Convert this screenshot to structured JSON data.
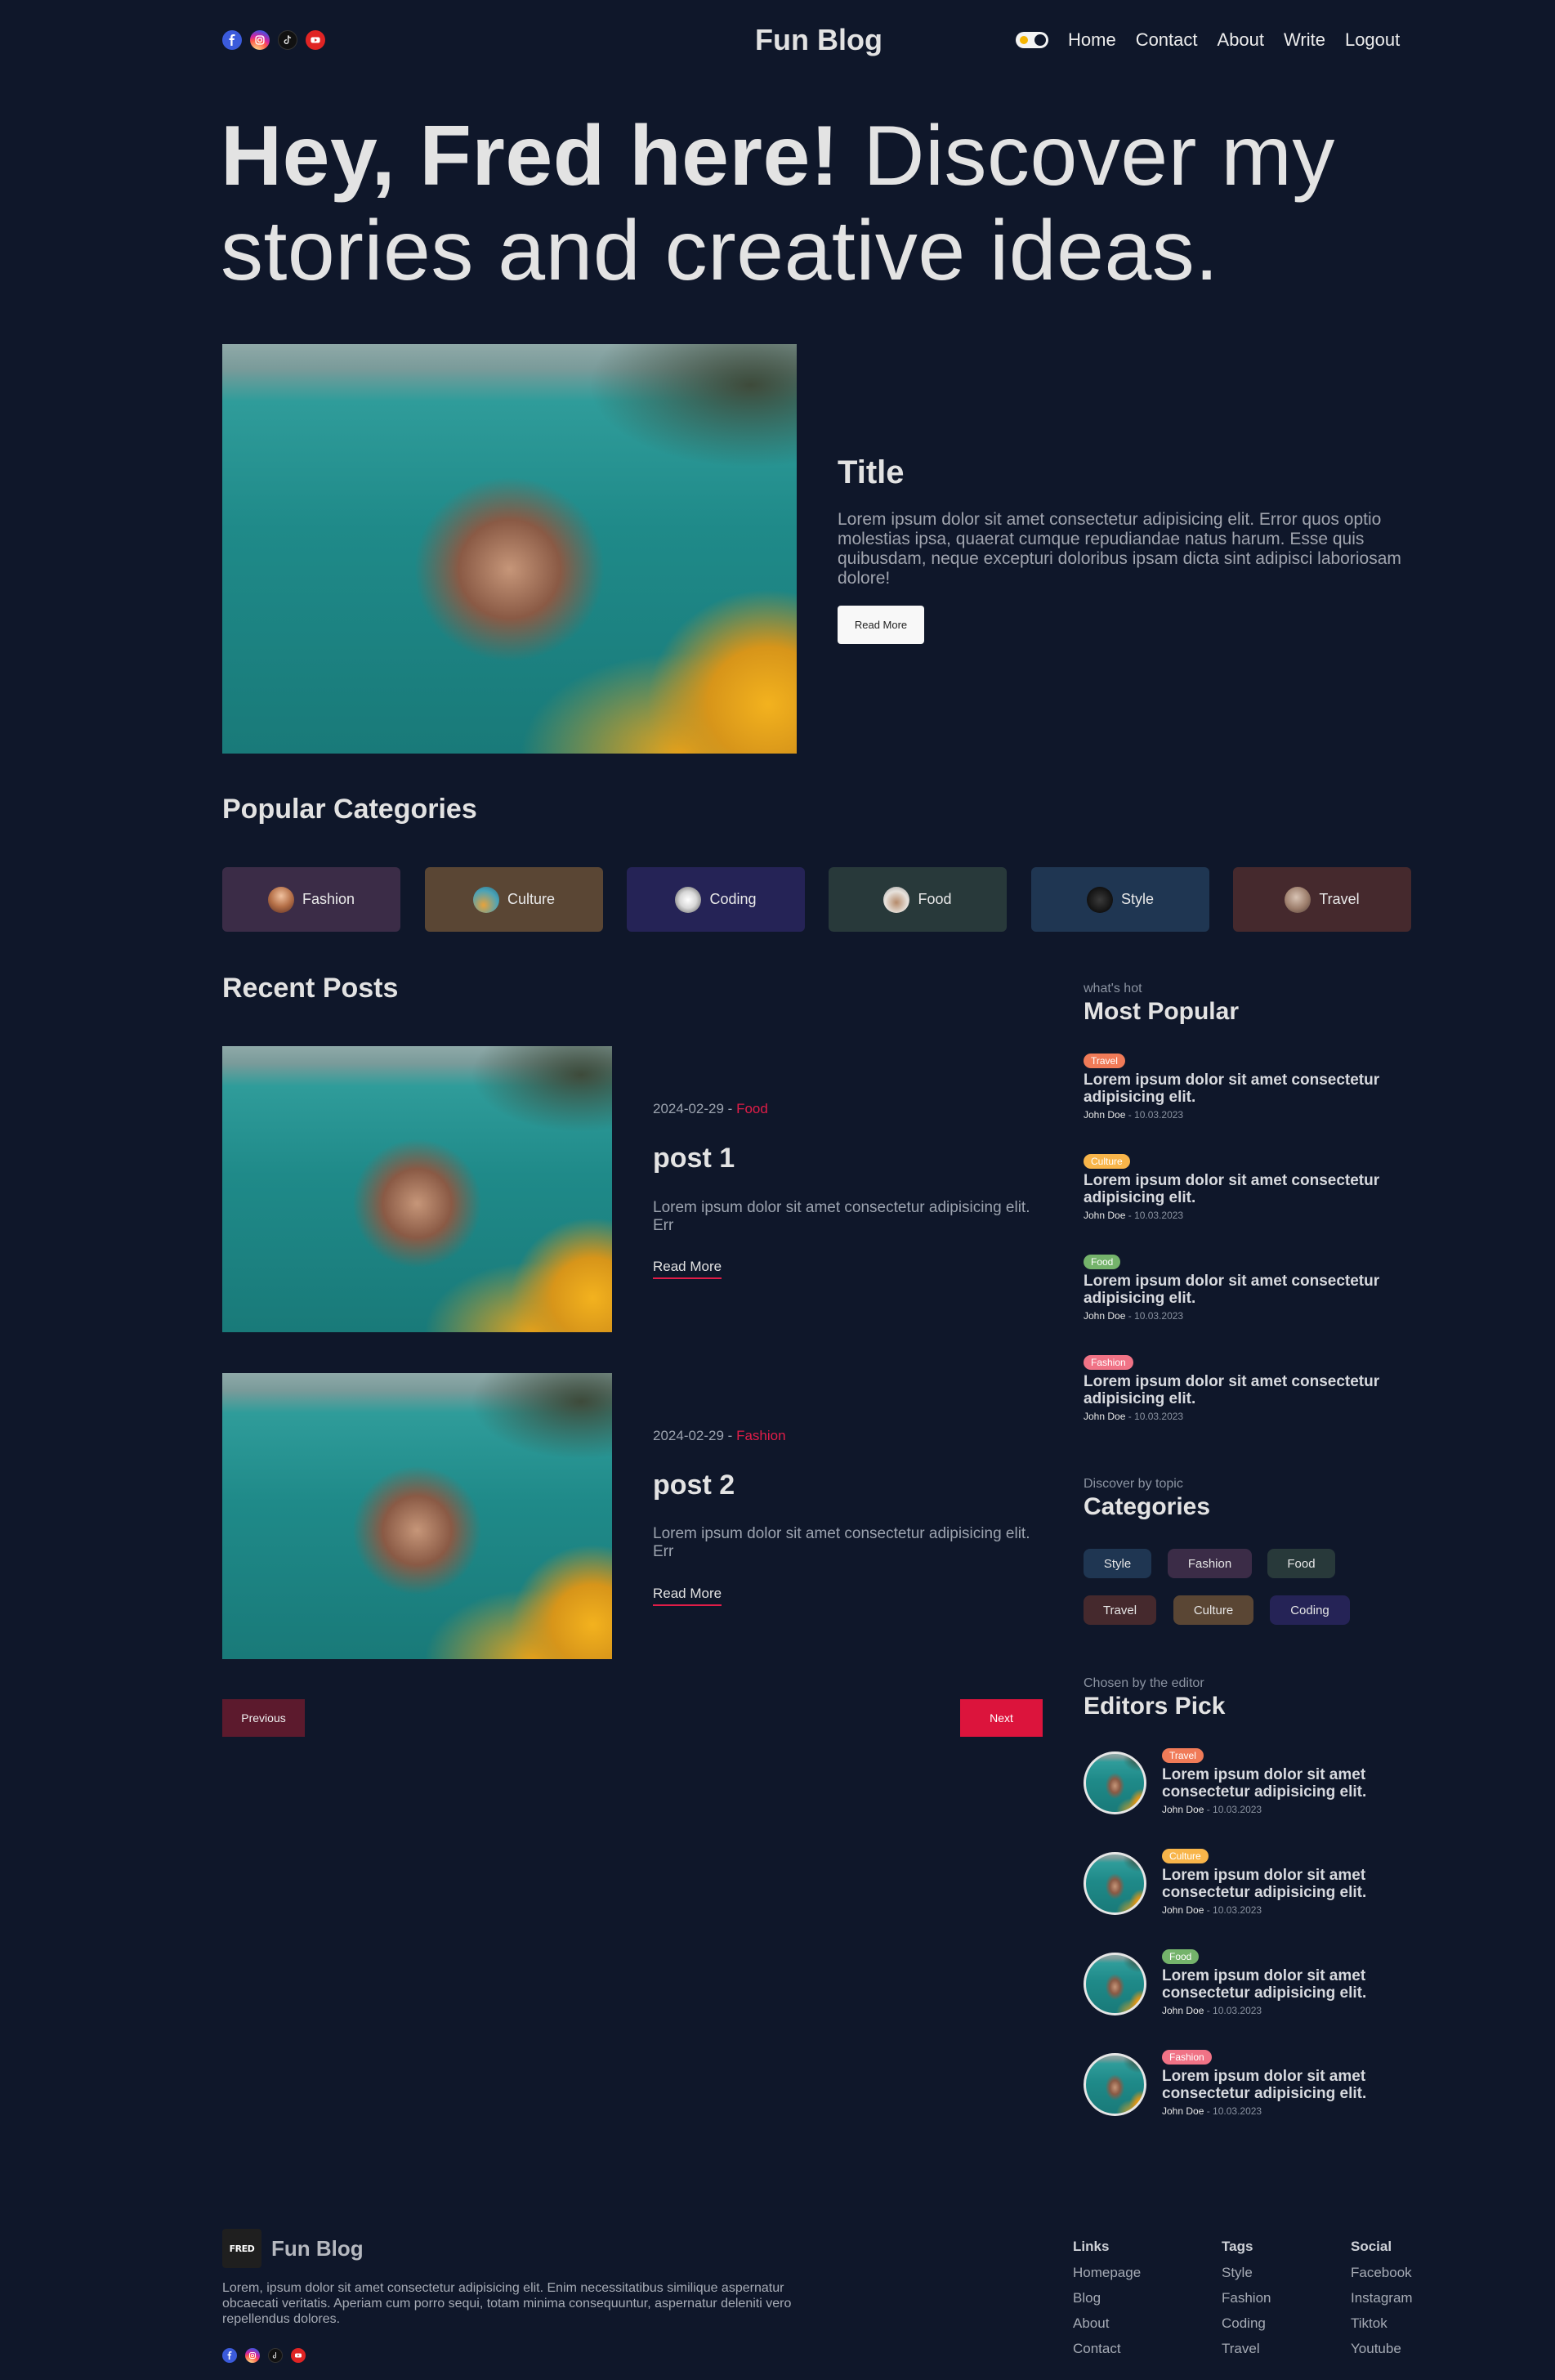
{
  "nav": {
    "logo": "Fun Blog",
    "links": [
      "Home",
      "Contact",
      "About",
      "Write",
      "Logout"
    ],
    "social_icons": [
      "facebook-icon",
      "instagram-icon",
      "tiktok-icon",
      "youtube-icon"
    ]
  },
  "hero": {
    "title_bold": "Hey, Fred here!",
    "title_rest": " Discover my stories and creative ideas."
  },
  "featured": {
    "title": "Title",
    "description": "Lorem ipsum dolor sit amet consectetur adipisicing elit. Error quos optio molestias ipsa, quaerat cumque repudiandae natus harum. Esse quis quibusdam, neque excepturi doloribus ipsam dicta sint adipisci laboriosam dolore!",
    "button": "Read More"
  },
  "popular_categories": {
    "title": "Popular Categories",
    "items": [
      {
        "label": "Fashion",
        "color": "#3b2c47"
      },
      {
        "label": "Culture",
        "color": "#5a4634"
      },
      {
        "label": "Coding",
        "color": "#252356"
      },
      {
        "label": "Food",
        "color": "#28393a"
      },
      {
        "label": "Style",
        "color": "#1f3652"
      },
      {
        "label": "Travel",
        "color": "#45292d"
      }
    ]
  },
  "recent_posts": {
    "title": "Recent Posts",
    "posts": [
      {
        "date": "2024-02-29 - ",
        "category": "Food",
        "title": "post 1",
        "description": "Lorem ipsum dolor sit amet consectetur adipisicing elit. Err",
        "link": "Read More"
      },
      {
        "date": "2024-02-29 - ",
        "category": "Fashion",
        "title": "post 2",
        "description": "Lorem ipsum dolor sit amet consectetur adipisicing elit. Err",
        "link": "Read More"
      }
    ],
    "prev": "Previous",
    "next": "Next"
  },
  "most_popular": {
    "subtitle": "what's hot",
    "title": "Most Popular",
    "items": [
      {
        "tag": "Travel",
        "tag_color": "#f07b58",
        "title": "Lorem ipsum dolor sit amet consectetur adipisicing elit.",
        "author": "John Doe",
        "date": " - 10.03.2023"
      },
      {
        "tag": "Culture",
        "tag_color": "#f8b54a",
        "title": "Lorem ipsum dolor sit amet consectetur adipisicing elit.",
        "author": "John Doe",
        "date": " - 10.03.2023"
      },
      {
        "tag": "Food",
        "tag_color": "#74b36b",
        "title": "Lorem ipsum dolor sit amet consectetur adipisicing elit.",
        "author": "John Doe",
        "date": " - 10.03.2023"
      },
      {
        "tag": "Fashion",
        "tag_color": "#f07386",
        "title": "Lorem ipsum dolor sit amet consectetur adipisicing elit.",
        "author": "John Doe",
        "date": " - 10.03.2023"
      }
    ]
  },
  "categories": {
    "subtitle": "Discover by topic",
    "title": "Categories",
    "chips": [
      {
        "label": "Style",
        "color": "#1f3652"
      },
      {
        "label": "Fashion",
        "color": "#3b2c47"
      },
      {
        "label": "Food",
        "color": "#28393a"
      },
      {
        "label": "Travel",
        "color": "#45292d"
      },
      {
        "label": "Culture",
        "color": "#5a4634"
      },
      {
        "label": "Coding",
        "color": "#252356"
      }
    ]
  },
  "editors_pick": {
    "subtitle": "Chosen by the editor",
    "title": "Editors Pick",
    "items": [
      {
        "tag": "Travel",
        "tag_color": "#f07b58",
        "title": "Lorem ipsum dolor sit amet consectetur adipisicing elit.",
        "author": "John Doe",
        "date": " - 10.03.2023"
      },
      {
        "tag": "Culture",
        "tag_color": "#f8b54a",
        "title": "Lorem ipsum dolor sit amet consectetur adipisicing elit.",
        "author": "John Doe",
        "date": " - 10.03.2023"
      },
      {
        "tag": "Food",
        "tag_color": "#74b36b",
        "title": "Lorem ipsum dolor sit amet consectetur adipisicing elit.",
        "author": "John Doe",
        "date": " - 10.03.2023"
      },
      {
        "tag": "Fashion",
        "tag_color": "#f07386",
        "title": "Lorem ipsum dolor sit amet consectetur adipisicing elit.",
        "author": "John Doe",
        "date": " - 10.03.2023"
      }
    ]
  },
  "footer": {
    "logo_text": "FRED",
    "brand": "Fun Blog",
    "description": "Lorem, ipsum dolor sit amet consectetur adipisicing elit. Enim necessitatibus similique aspernatur obcaecati veritatis. Aperiam cum porro sequi, totam minima consequuntur, aspernatur deleniti vero repellendus dolores.",
    "columns": [
      {
        "title": "Links",
        "items": [
          "Homepage",
          "Blog",
          "About",
          "Contact"
        ]
      },
      {
        "title": "Tags",
        "items": [
          "Style",
          "Fashion",
          "Coding",
          "Travel"
        ]
      },
      {
        "title": "Social",
        "items": [
          "Facebook",
          "Instagram",
          "Tiktok",
          "Youtube"
        ]
      }
    ]
  }
}
